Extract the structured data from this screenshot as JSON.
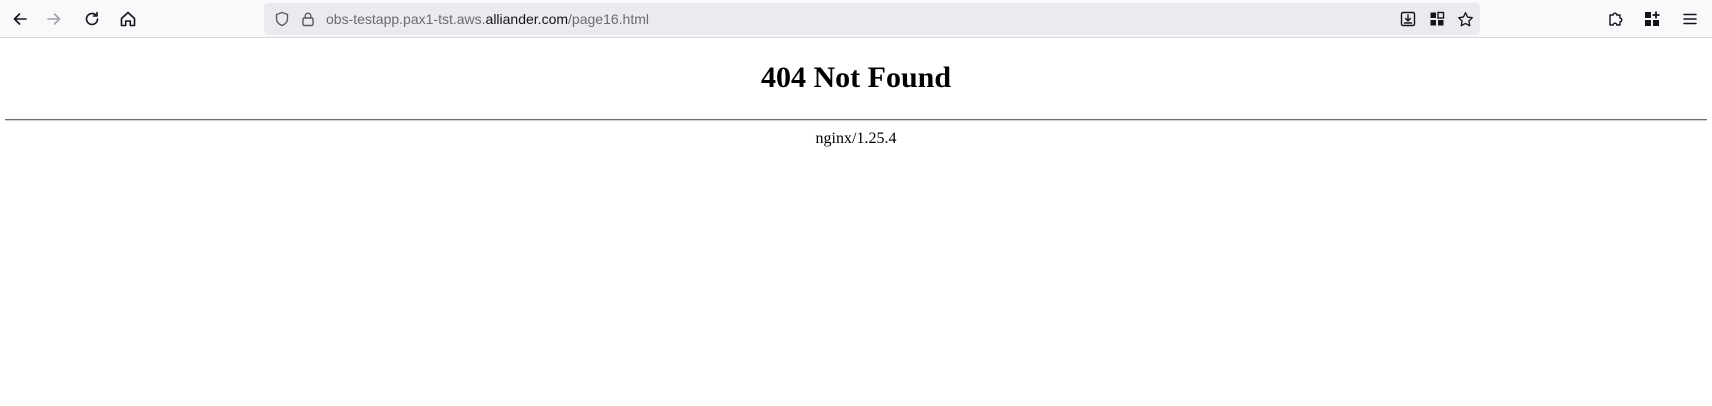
{
  "browser": {
    "url": {
      "prefix": "obs-testapp.pax1-tst.aws.",
      "domain": "alliander.com",
      "path": "/page16.html"
    },
    "icons": {
      "back": "arrow-left-icon",
      "forward": "arrow-right-icon",
      "reload": "reload-icon",
      "home": "home-icon",
      "tracking_protection": "shield-icon",
      "security": "lock-icon",
      "save_to_pocket": "download-tray-icon",
      "grid": "grid-icon",
      "bookmark": "star-icon",
      "extensions": "puzzle-icon",
      "apps": "apps-icon",
      "menu": "hamburger-menu-icon"
    },
    "forward_disabled": true
  },
  "page": {
    "heading": "404 Not Found",
    "server_signature": "nginx/1.25.4"
  }
}
